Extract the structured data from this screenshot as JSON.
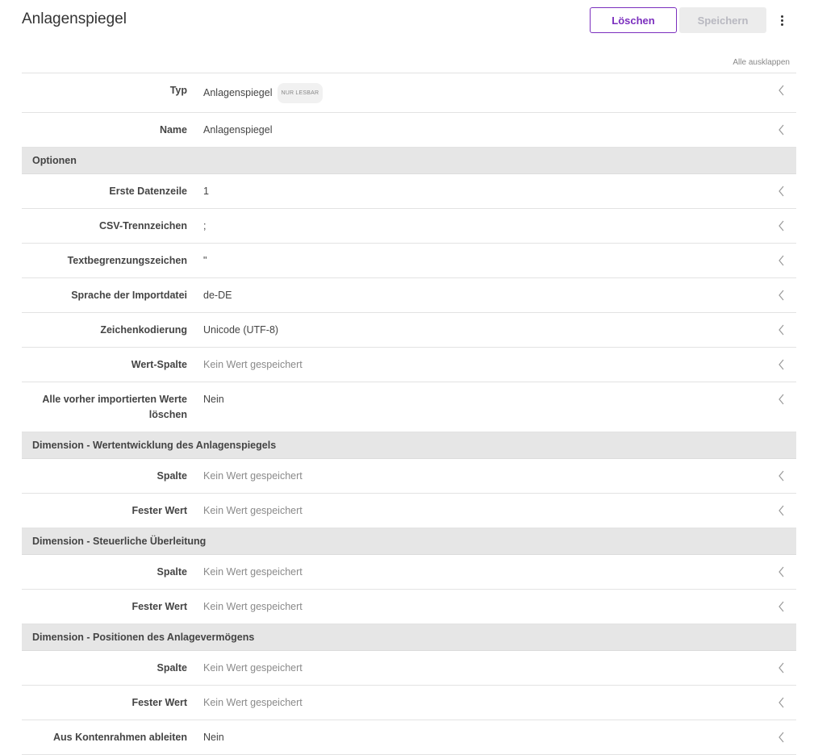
{
  "header": {
    "title": "Anlagenspiegel",
    "delete_label": "Löschen",
    "save_label": "Speichern",
    "expand_all_label": "Alle ausklappen"
  },
  "badge_readonly": "NUR LESBAR",
  "top_fields": [
    {
      "label": "Typ",
      "value": "Anlagenspiegel"
    },
    {
      "label": "Name",
      "value": "Anlagenspiegel"
    }
  ],
  "sections": [
    {
      "title": "Optionen",
      "fields": [
        {
          "label": "Erste Datenzeile",
          "value": "1"
        },
        {
          "label": "CSV-Trennzeichen",
          "value": ";"
        },
        {
          "label": "Textbegrenzungszeichen",
          "value": "\""
        },
        {
          "label": "Sprache der Importdatei",
          "value": "de-DE"
        },
        {
          "label": "Zeichenkodierung",
          "value": "Unicode (UTF-8)"
        },
        {
          "label": "Wert-Spalte",
          "value": "Kein Wert gespeichert"
        },
        {
          "label": "Alle vorher importierten Werte löschen",
          "value": "Nein"
        }
      ]
    },
    {
      "title": "Dimension - Wertentwicklung des Anlagenspiegels",
      "fields": [
        {
          "label": "Spalte",
          "value": "Kein Wert gespeichert"
        },
        {
          "label": "Fester Wert",
          "value": "Kein Wert gespeichert"
        }
      ]
    },
    {
      "title": "Dimension - Steuerliche Überleitung",
      "fields": [
        {
          "label": "Spalte",
          "value": "Kein Wert gespeichert"
        },
        {
          "label": "Fester Wert",
          "value": "Kein Wert gespeichert"
        }
      ]
    },
    {
      "title": "Dimension - Positionen des Anlagevermögens",
      "fields": [
        {
          "label": "Spalte",
          "value": "Kein Wert gespeichert"
        },
        {
          "label": "Fester Wert",
          "value": "Kein Wert gespeichert"
        },
        {
          "label": "Aus Kontenrahmen ableiten",
          "value": "Nein"
        }
      ]
    }
  ],
  "colors": {
    "accent": "#7b2fbe",
    "section_bg": "#e6e6e6",
    "empty_value": "#8a8a8a"
  },
  "icons": {
    "row_toggle": "chevron-left-icon",
    "menu": "more-vertical-icon"
  }
}
